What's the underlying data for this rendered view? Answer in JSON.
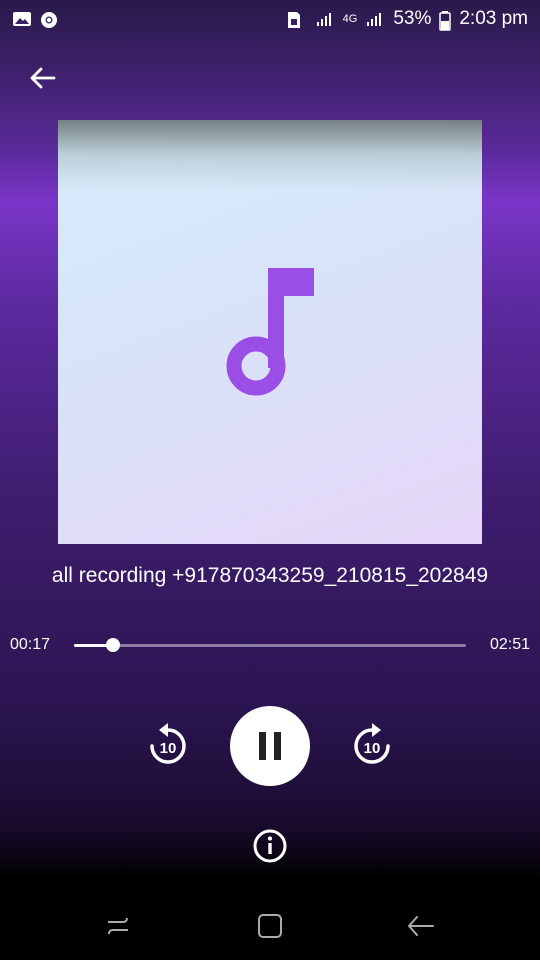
{
  "status_bar": {
    "battery": "53%",
    "time": "2:03 pm",
    "network": "4G",
    "icons": [
      "gallery-icon",
      "chrome-icon",
      "sim-icon",
      "signal-icon",
      "signal-icon",
      "battery-icon"
    ]
  },
  "player": {
    "title": "all recording +917870343259_210815_202849",
    "elapsed": "00:17",
    "total": "02:51",
    "progress_fraction": 0.099,
    "rewind_label": "10",
    "forward_label": "10"
  },
  "colors": {
    "accent": "#9b4ee6",
    "background_top": "#2a1a4a",
    "background_mid": "#7a35c8"
  }
}
